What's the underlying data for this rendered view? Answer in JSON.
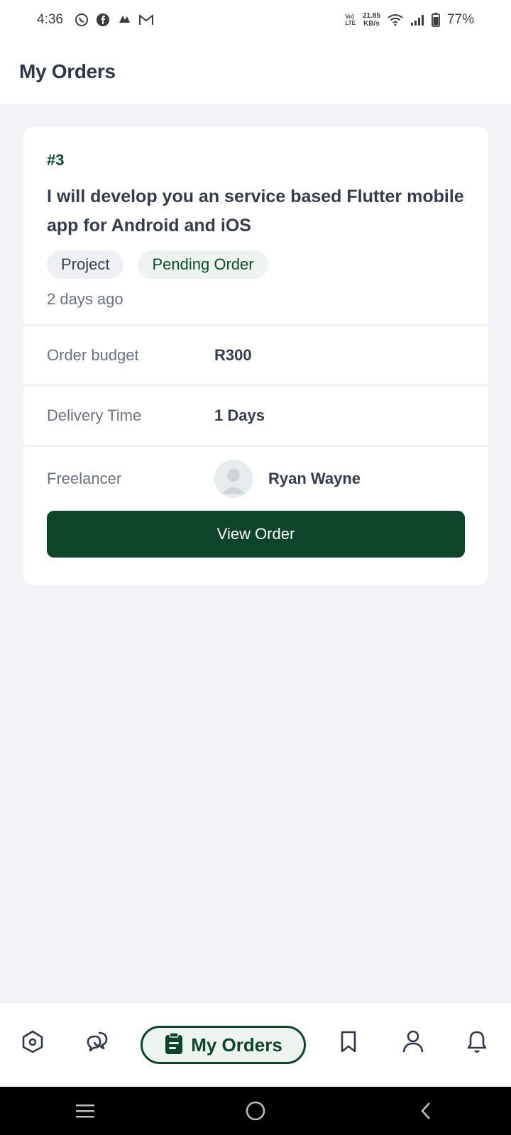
{
  "status_bar": {
    "time": "4:36",
    "notification_icons": [
      "whatsapp-icon",
      "facebook-icon",
      "cloud-icon",
      "gmail-icon"
    ],
    "volte_line1": "Vo)",
    "volte_line2": "LTE",
    "speed_value": "21.85",
    "speed_unit": "KB/s",
    "battery": "77%"
  },
  "header": {
    "title": "My Orders"
  },
  "order": {
    "id": "#3",
    "title": "I will develop you an service based Flutter mobile app for Android and iOS",
    "tags": [
      "Project",
      "Pending Order"
    ],
    "time_ago": "2 days ago",
    "budget_label": "Order budget",
    "budget_value": "R300",
    "delivery_label": "Delivery Time",
    "delivery_value": "1 Days",
    "freelancer_label": "Freelancer",
    "freelancer_name": "Ryan Wayne",
    "view_button": "View Order"
  },
  "bottom_nav": {
    "items": [
      "home-icon",
      "chat-icon",
      "orders-icon",
      "bookmark-icon",
      "profile-icon",
      "bell-icon"
    ],
    "active_label": "My Orders"
  },
  "colors": {
    "brand_green": "#0e4429",
    "background": "#f1f3f7"
  }
}
